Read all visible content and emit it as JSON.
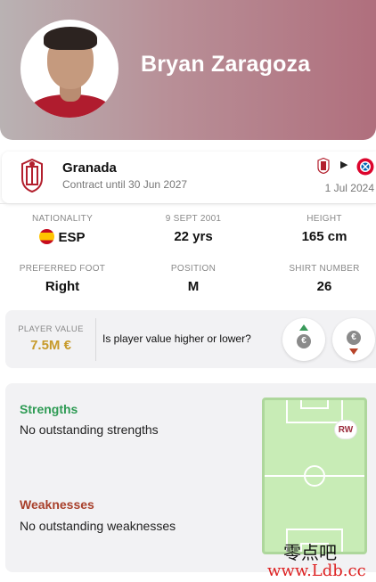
{
  "player": {
    "name": "Bryan Zaragoza"
  },
  "club": {
    "name": "Granada",
    "contract": "Contract until 30 Jun 2027",
    "transfer_date": "1 Jul 2024",
    "arrow": "▶"
  },
  "info": {
    "nationality_label": "NATIONALITY",
    "nationality": "ESP",
    "dob_label": "9 SEPT 2001",
    "age": "22 yrs",
    "height_label": "HEIGHT",
    "height": "165 cm",
    "foot_label": "PREFERRED FOOT",
    "foot": "Right",
    "position_label": "POSITION",
    "position": "M",
    "shirt_label": "SHIRT NUMBER",
    "shirt": "26"
  },
  "value": {
    "label": "PLAYER VALUE",
    "amount": "7.5M €",
    "question": "Is player value higher or lower?",
    "coin_symbol": "€"
  },
  "strengths": {
    "title": "Strengths",
    "text": "No outstanding strengths"
  },
  "weaknesses": {
    "title": "Weaknesses",
    "text": "No outstanding weaknesses"
  },
  "pitch": {
    "position_badge": "RW"
  },
  "watermark": {
    "line1": "零点吧",
    "line2": "www.Ldb.cc"
  },
  "colors": {
    "strengths": "#2e9b54",
    "weaknesses": "#a8402b",
    "value": "#c79a2a"
  }
}
